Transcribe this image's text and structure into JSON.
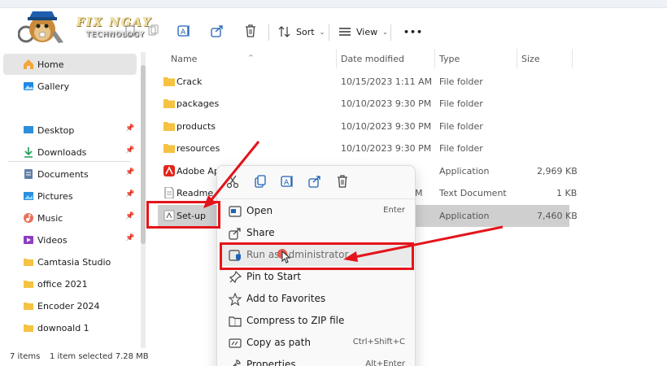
{
  "logo": {
    "title": "FIX NGAY",
    "subtitle": "TECHNOLOGY"
  },
  "toolbar": {
    "sort_label": "Sort",
    "view_label": "View",
    "more_label": "•••"
  },
  "nav": {
    "items": [
      {
        "label": "Home",
        "icon": "home-icon",
        "selected": true
      },
      {
        "label": "Gallery",
        "icon": "gallery-icon"
      },
      {
        "label": "Desktop",
        "icon": "desktop-icon",
        "pinned": true
      },
      {
        "label": "Downloads",
        "icon": "downloads-icon",
        "pinned": true
      },
      {
        "label": "Documents",
        "icon": "documents-icon",
        "pinned": true
      },
      {
        "label": "Pictures",
        "icon": "pictures-icon",
        "pinned": true
      },
      {
        "label": "Music",
        "icon": "music-icon",
        "pinned": true
      },
      {
        "label": "Videos",
        "icon": "videos-icon",
        "pinned": true
      },
      {
        "label": "Camtasia Studio",
        "icon": "folder-icon"
      },
      {
        "label": "office 2021",
        "icon": "folder-icon"
      },
      {
        "label": "Encoder 2024",
        "icon": "folder-icon"
      },
      {
        "label": "downoald 1",
        "icon": "folder-icon"
      }
    ]
  },
  "list": {
    "headers": {
      "name": "Name",
      "date": "Date modified",
      "type": "Type",
      "size": "Size"
    },
    "rows": [
      {
        "name": "Crack",
        "date": "10/15/2023 1:11 AM",
        "type": "File folder",
        "size": "",
        "icon": "folder-icon"
      },
      {
        "name": "packages",
        "date": "10/10/2023 9:30 PM",
        "type": "File folder",
        "size": "",
        "icon": "folder-icon"
      },
      {
        "name": "products",
        "date": "10/10/2023 9:30 PM",
        "type": "File folder",
        "size": "",
        "icon": "folder-icon"
      },
      {
        "name": "resources",
        "date": "10/10/2023 9:30 PM",
        "type": "File folder",
        "size": "",
        "icon": "folder-icon"
      },
      {
        "name": "Adobe App",
        "date": "",
        "type": "Application",
        "size": "2,969 KB",
        "icon": "adobe-app-icon"
      },
      {
        "name": "Readme",
        "date": "M",
        "type": "Text Document",
        "size": "1 KB",
        "icon": "text-file-icon"
      },
      {
        "name": "Set-up",
        "date": "",
        "type": "Application",
        "size": "7,460 KB",
        "icon": "setup-app-icon",
        "selected": true
      }
    ]
  },
  "context_menu": {
    "items": [
      {
        "label": "Open",
        "shortcut": "Enter",
        "icon": "open-icon"
      },
      {
        "label": "Share",
        "shortcut": "",
        "icon": "share-icon"
      },
      {
        "label": "Run as administrator",
        "shortcut": "",
        "icon": "shield-icon",
        "highlighted": true
      },
      {
        "label": "Pin to Start",
        "shortcut": "",
        "icon": "pin-icon"
      },
      {
        "label": "Add to Favorites",
        "shortcut": "",
        "icon": "star-icon"
      },
      {
        "label": "Compress to ZIP file",
        "shortcut": "",
        "icon": "zip-icon"
      },
      {
        "label": "Copy as path",
        "shortcut": "Ctrl+Shift+C",
        "icon": "path-icon"
      },
      {
        "label": "Properties",
        "shortcut": "Alt+Enter",
        "icon": "properties-icon"
      }
    ]
  },
  "status": {
    "items_count": "7 items",
    "selected": "1 item selected  7.28 MB"
  },
  "colors": {
    "accent": "#0067c0",
    "annotation_red": "#e4141b",
    "folder": "#f5c242"
  }
}
